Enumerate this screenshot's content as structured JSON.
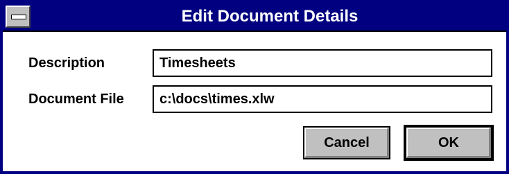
{
  "window": {
    "title": "Edit Document Details"
  },
  "form": {
    "description_label": "Description",
    "description_value": "Timesheets",
    "file_label": "Document File",
    "file_value": "c:\\docs\\times.xlw"
  },
  "buttons": {
    "cancel_label": "Cancel",
    "ok_label": "OK"
  },
  "colors": {
    "titlebar": "#000080",
    "button_face": "#c0c0c0"
  },
  "icons": {
    "system_menu": "system-menu-icon"
  }
}
